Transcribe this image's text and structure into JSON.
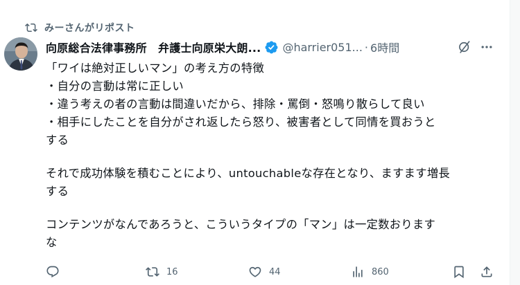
{
  "repost": {
    "label": "みーさんがリポスト"
  },
  "author": {
    "name": "向原総合法律事務所　弁護士向原栄大朗...",
    "handle": "@harrier051...",
    "separator": "·",
    "time": "6時間"
  },
  "post": {
    "lines": [
      "「ワイは絶対正しいマン」の考え方の特徴",
      "・自分の言動は常に正しい",
      "・違う考えの者の言動は間違いだから、排除・罵倒・怒鳴り散らして良い",
      "・相手にしたことを自分がされ返したら怒り、被害者として同情を買おうと",
      "する",
      "",
      "それで成功体験を積むことにより、untouchableな存在となり、ますます増長",
      "する",
      "",
      "コンテンツがなんであろうと、こういうタイプの「マン」は一定数おります",
      "な"
    ]
  },
  "actions": {
    "reply_count": "",
    "repost_count": "16",
    "like_count": "44",
    "views_count": "860"
  },
  "colors": {
    "text": "#0f1419",
    "secondary": "#536471",
    "verified": "#1d9bf0"
  },
  "icons": [
    "repost-icon",
    "verified-badge-icon",
    "grok-icon",
    "more-icon",
    "reply-icon",
    "like-icon",
    "views-icon",
    "bookmark-icon",
    "share-icon"
  ]
}
